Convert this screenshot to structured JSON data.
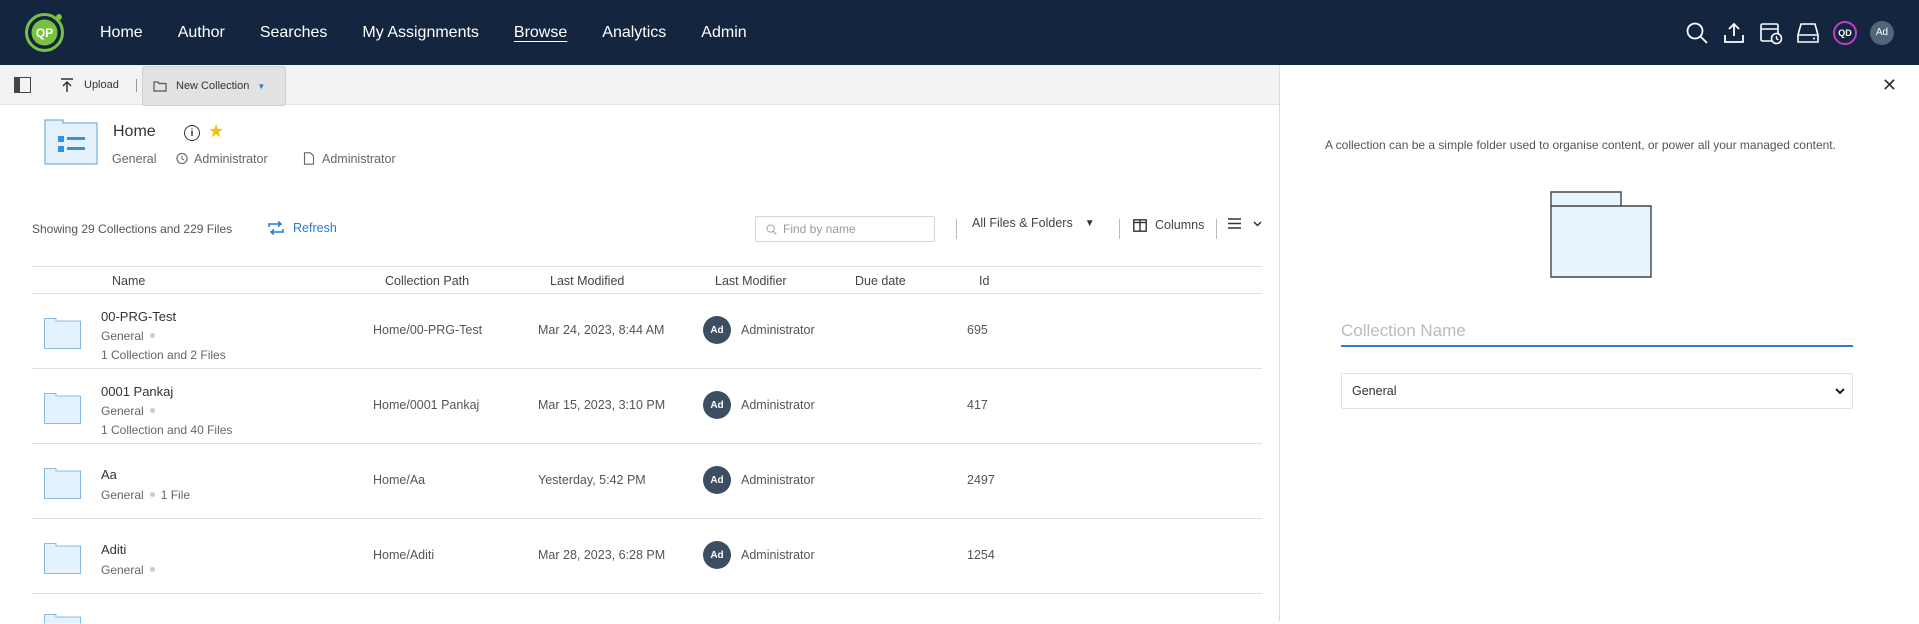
{
  "nav": {
    "logo_text": "QP",
    "links": [
      "Home",
      "Author",
      "Searches",
      "My Assignments",
      "Browse",
      "Analytics",
      "Admin"
    ],
    "active": "Browse",
    "user_badge": "QD",
    "avatar": "Ad",
    "icons": [
      "search-icon",
      "upload-icon",
      "scheduler-icon",
      "drive-icon"
    ]
  },
  "toolbar": {
    "upload_label": "Upload",
    "new_collection_label": "New Collection"
  },
  "header": {
    "title": "Home",
    "type": "General",
    "owner": "Administrator",
    "modifier": "Administrator"
  },
  "listbar": {
    "showing": "Showing 29 Collections and 229 Files",
    "refresh_label": "Refresh",
    "search_placeholder": "Find by name",
    "filter_label": "All Files & Folders",
    "columns_label": "Columns"
  },
  "table": {
    "headers": [
      "Name",
      "Collection Path",
      "Last Modified",
      "Last Modifier",
      "Due date",
      "Id"
    ],
    "rows": [
      {
        "name": "00-PRG-Test",
        "type": "General",
        "extra": "",
        "sub": "1 Collection and 2 Files",
        "path": "Home/00-PRG-Test",
        "modified": "Mar 24, 2023, 8:44 AM",
        "avatar": "Ad",
        "modifier": "Administrator",
        "due": "",
        "id": "695"
      },
      {
        "name": "0001 Pankaj",
        "type": "General",
        "extra": "",
        "sub": "1 Collection and 40 Files",
        "path": "Home/0001 Pankaj",
        "modified": "Mar 15, 2023, 3:10 PM",
        "avatar": "Ad",
        "modifier": "Administrator",
        "due": "",
        "id": "417"
      },
      {
        "name": "Aa",
        "type": "General",
        "extra": "1 File",
        "sub": "",
        "path": "Home/Aa",
        "modified": "Yesterday, 5:42 PM",
        "avatar": "Ad",
        "modifier": "Administrator",
        "due": "",
        "id": "2497"
      },
      {
        "name": "Aditi",
        "type": "General",
        "extra": "",
        "sub": "",
        "path": "Home/Aditi",
        "modified": "Mar 28, 2023, 6:28 PM",
        "avatar": "Ad",
        "modifier": "Administrator",
        "due": "",
        "id": "1254"
      }
    ]
  },
  "panel": {
    "description": "A collection can be a simple folder used to organise content, or power all your managed content.",
    "name_placeholder": "Collection Name",
    "type_value": "General"
  },
  "colors": {
    "nav_bg": "#14263f",
    "accent": "#2a7bd3",
    "logo_green": "#7ac143",
    "star": "#f3c300",
    "folder_fill": "#e3f2fc"
  }
}
